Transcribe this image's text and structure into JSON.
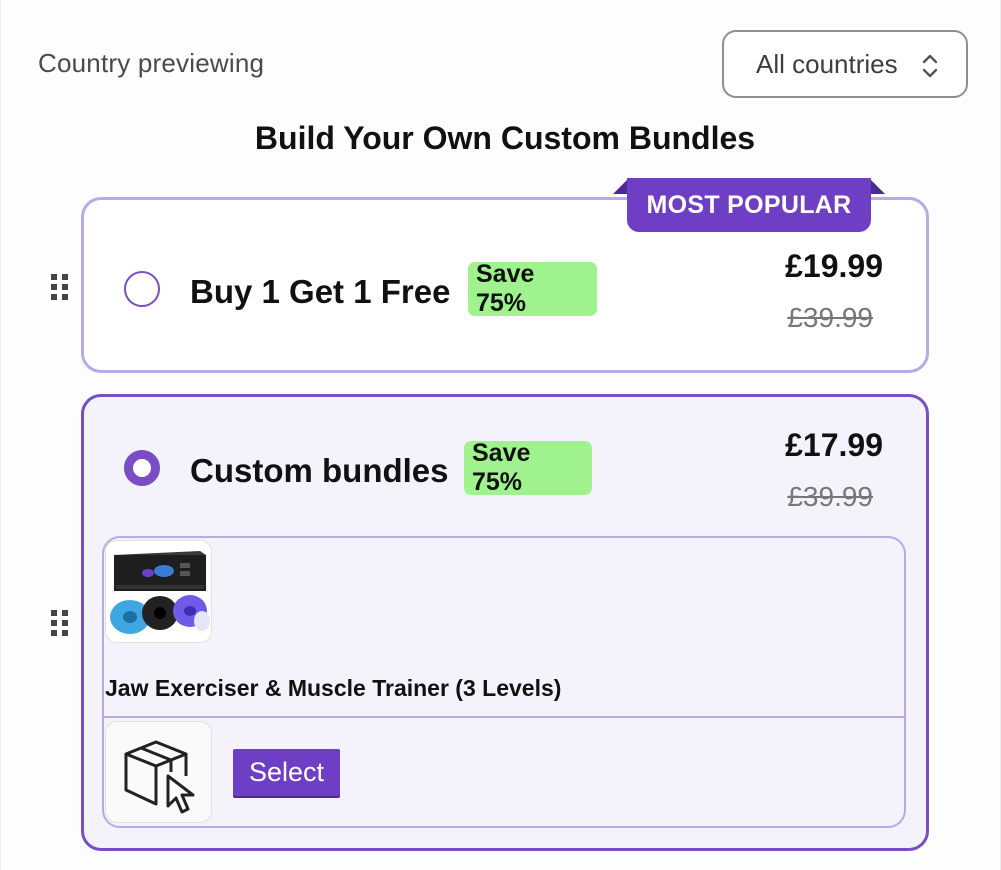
{
  "country": {
    "label": "Country previewing",
    "selected": "All countries"
  },
  "heading": "Build Your Own Custom Bundles",
  "options": [
    {
      "title": "Buy 1 Get 1 Free",
      "save_label": "Save 75%",
      "price": "£19.99",
      "original_price": "£39.99",
      "badge": "MOST POPULAR",
      "selected": false
    },
    {
      "title": "Custom bundles",
      "save_label": "Save 75%",
      "price": "£17.99",
      "original_price": "£39.99",
      "selected": true,
      "product": {
        "name": "Jaw Exerciser & Muscle Trainer (3 Levels)"
      },
      "select_button": "Select"
    }
  ],
  "colors": {
    "accent": "#6e3fc4",
    "accent_border": "#7a4cc5",
    "light_border": "#b9a9e6",
    "save_bg": "#9ff28e",
    "selected_card_bg": "#f4f2fa"
  },
  "icons": {
    "select_chevrons": "chevron-up-down-icon",
    "drag": "drag-handle-icon",
    "box_cursor": "box-cursor-icon"
  }
}
